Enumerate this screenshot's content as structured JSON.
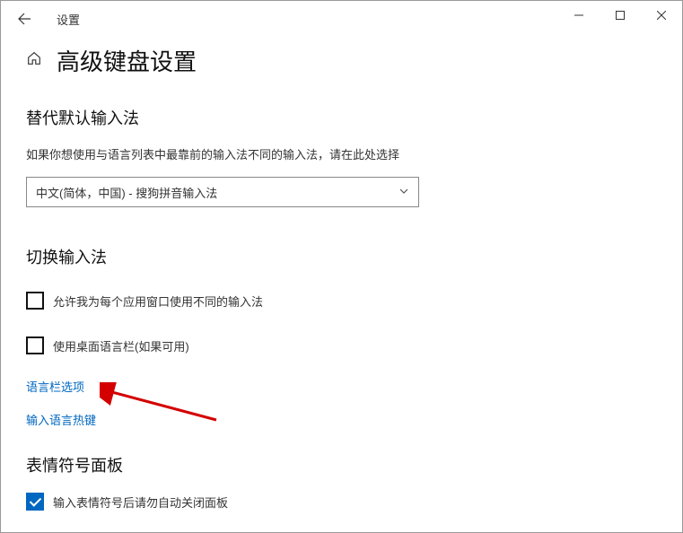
{
  "window": {
    "title": "设置"
  },
  "page": {
    "title": "高级键盘设置"
  },
  "section1": {
    "title": "替代默认输入法",
    "desc": "如果你想使用与语言列表中最靠前的输入法不同的输入法，请在此处选择",
    "dropdown_value": "中文(简体，中国) - 搜狗拼音输入法"
  },
  "section2": {
    "title": "切换输入法",
    "checkbox1": "允许我为每个应用窗口使用不同的输入法",
    "checkbox2": "使用桌面语言栏(如果可用)",
    "link1": "语言栏选项",
    "link2": "输入语言热键"
  },
  "section3": {
    "title": "表情符号面板",
    "checkbox1": "输入表情符号后请勿自动关闭面板"
  }
}
